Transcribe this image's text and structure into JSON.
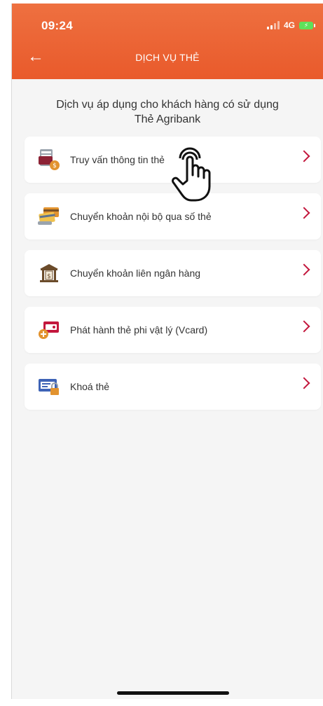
{
  "status": {
    "time": "09:24",
    "network": "4G"
  },
  "nav": {
    "title": "DỊCH VỤ THẺ"
  },
  "intro": {
    "line1": "Dịch vụ áp dụng cho khách hàng có sử dụng",
    "line2": "Thẻ Agribank"
  },
  "items": [
    {
      "label": "Truy vấn thông tin thẻ",
      "icon": "card-info-icon"
    },
    {
      "label": "Chuyển khoản nội bộ qua số thẻ",
      "icon": "card-transfer-icon"
    },
    {
      "label": "Chuyển khoản liên ngân hàng",
      "icon": "bank-icon"
    },
    {
      "label": "Phát hành thẻ phi vật lý (Vcard)",
      "icon": "virtual-card-icon"
    },
    {
      "label": "Khoá thẻ",
      "icon": "card-lock-icon"
    }
  ],
  "colors": {
    "header": "#e95a2b",
    "accent": "#c3173d"
  }
}
